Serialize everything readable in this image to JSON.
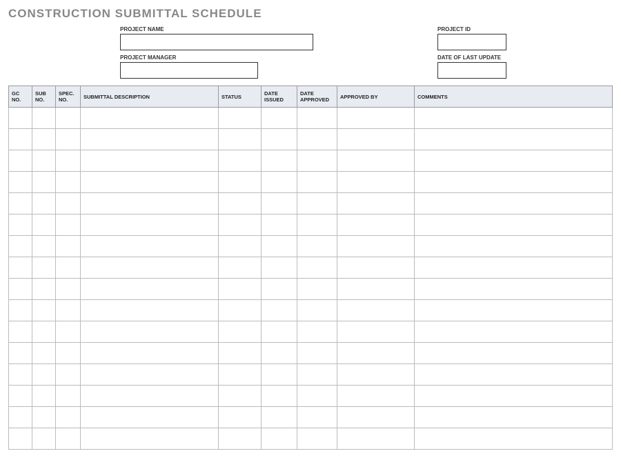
{
  "title": "CONSTRUCTION SUBMITTAL SCHEDULE",
  "meta": {
    "projectNameLabel": "PROJECT NAME",
    "projectNameValue": "",
    "projectManagerLabel": "PROJECT MANAGER",
    "projectManagerValue": "",
    "projectIdLabel": "PROJECT ID",
    "projectIdValue": "",
    "lastUpdateLabel": "DATE OF LAST UPDATE",
    "lastUpdateValue": ""
  },
  "columns": {
    "gcNo": "GC NO.",
    "subNo": "SUB NO.",
    "specNo": "SPEC. NO.",
    "description": "SUBMITTAL DESCRIPTION",
    "status": "STATUS",
    "dateIssued": "DATE ISSUED",
    "dateApproved": "DATE APPROVED",
    "approvedBy": "APPROVED BY",
    "comments": "COMMENTS"
  },
  "rows": [
    {
      "gcNo": "",
      "subNo": "",
      "specNo": "",
      "description": "",
      "status": "",
      "dateIssued": "",
      "dateApproved": "",
      "approvedBy": "",
      "comments": ""
    },
    {
      "gcNo": "",
      "subNo": "",
      "specNo": "",
      "description": "",
      "status": "",
      "dateIssued": "",
      "dateApproved": "",
      "approvedBy": "",
      "comments": ""
    },
    {
      "gcNo": "",
      "subNo": "",
      "specNo": "",
      "description": "",
      "status": "",
      "dateIssued": "",
      "dateApproved": "",
      "approvedBy": "",
      "comments": ""
    },
    {
      "gcNo": "",
      "subNo": "",
      "specNo": "",
      "description": "",
      "status": "",
      "dateIssued": "",
      "dateApproved": "",
      "approvedBy": "",
      "comments": ""
    },
    {
      "gcNo": "",
      "subNo": "",
      "specNo": "",
      "description": "",
      "status": "",
      "dateIssued": "",
      "dateApproved": "",
      "approvedBy": "",
      "comments": ""
    },
    {
      "gcNo": "",
      "subNo": "",
      "specNo": "",
      "description": "",
      "status": "",
      "dateIssued": "",
      "dateApproved": "",
      "approvedBy": "",
      "comments": ""
    },
    {
      "gcNo": "",
      "subNo": "",
      "specNo": "",
      "description": "",
      "status": "",
      "dateIssued": "",
      "dateApproved": "",
      "approvedBy": "",
      "comments": ""
    },
    {
      "gcNo": "",
      "subNo": "",
      "specNo": "",
      "description": "",
      "status": "",
      "dateIssued": "",
      "dateApproved": "",
      "approvedBy": "",
      "comments": ""
    },
    {
      "gcNo": "",
      "subNo": "",
      "specNo": "",
      "description": "",
      "status": "",
      "dateIssued": "",
      "dateApproved": "",
      "approvedBy": "",
      "comments": ""
    },
    {
      "gcNo": "",
      "subNo": "",
      "specNo": "",
      "description": "",
      "status": "",
      "dateIssued": "",
      "dateApproved": "",
      "approvedBy": "",
      "comments": ""
    },
    {
      "gcNo": "",
      "subNo": "",
      "specNo": "",
      "description": "",
      "status": "",
      "dateIssued": "",
      "dateApproved": "",
      "approvedBy": "",
      "comments": ""
    },
    {
      "gcNo": "",
      "subNo": "",
      "specNo": "",
      "description": "",
      "status": "",
      "dateIssued": "",
      "dateApproved": "",
      "approvedBy": "",
      "comments": ""
    },
    {
      "gcNo": "",
      "subNo": "",
      "specNo": "",
      "description": "",
      "status": "",
      "dateIssued": "",
      "dateApproved": "",
      "approvedBy": "",
      "comments": ""
    },
    {
      "gcNo": "",
      "subNo": "",
      "specNo": "",
      "description": "",
      "status": "",
      "dateIssued": "",
      "dateApproved": "",
      "approvedBy": "",
      "comments": ""
    },
    {
      "gcNo": "",
      "subNo": "",
      "specNo": "",
      "description": "",
      "status": "",
      "dateIssued": "",
      "dateApproved": "",
      "approvedBy": "",
      "comments": ""
    },
    {
      "gcNo": "",
      "subNo": "",
      "specNo": "",
      "description": "",
      "status": "",
      "dateIssued": "",
      "dateApproved": "",
      "approvedBy": "",
      "comments": ""
    }
  ]
}
